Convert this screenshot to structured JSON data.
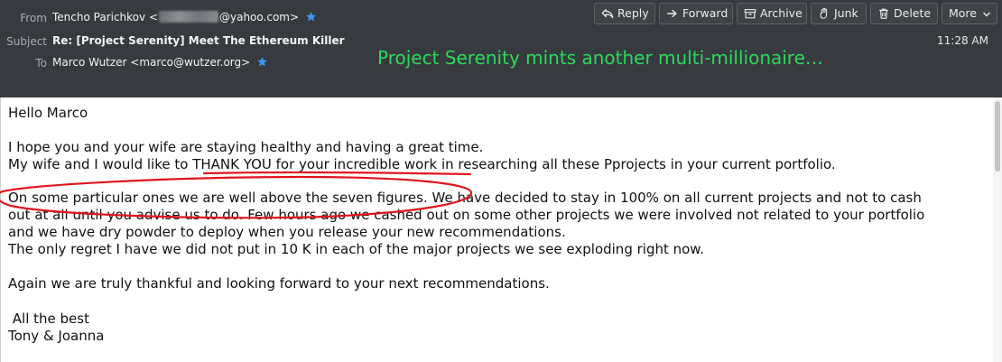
{
  "header": {
    "from_label": "From",
    "from_name": "Tencho Parichkov <",
    "from_domain": "@yahoo.com>",
    "subject_label": "Subject",
    "subject": "Re: [Project Serenity] Meet The Ethereum Killer",
    "to_label": "To",
    "to_value": "Marco Wutzer <marco@wutzer.org>",
    "time": "11:28 AM",
    "star_icon": "star-icon",
    "star_color": "#3a96f2"
  },
  "overlay_caption": "Project Serenity mints another multi-millionaire…",
  "toolbar": {
    "reply": "Reply",
    "forward": "Forward",
    "archive": "Archive",
    "junk": "Junk",
    "delete": "Delete",
    "more": "More"
  },
  "message": {
    "greeting": "Hello Marco",
    "line1": "I hope you and your wife are staying healthy and having a great time.",
    "line2_a": "My wife and I would like to ",
    "line2_b": "THANK YOU for your incredible work ",
    "line2_c": "in researching all these Pprojects in your current portfolio.",
    "line3": "On some particular ones we are well above the seven figures. We have decided to stay in 100% on all current projects and not to cash",
    "line4": "out at all until you advise us to do. Few hours ago we cashed out on some other projects we were involved not related to your portfolio",
    "line5": "and we have dry powder to deploy when you release your new recommendations.",
    "line6": "The only regret I have we did not put in 10 K in each of the major projects we see exploding right now.",
    "line7": "Again we are truly thankful and looking forward to your next recommendations.",
    "line8": " All the best",
    "line9": "Tony & Joanna"
  },
  "annotation_color": "#e0141e"
}
